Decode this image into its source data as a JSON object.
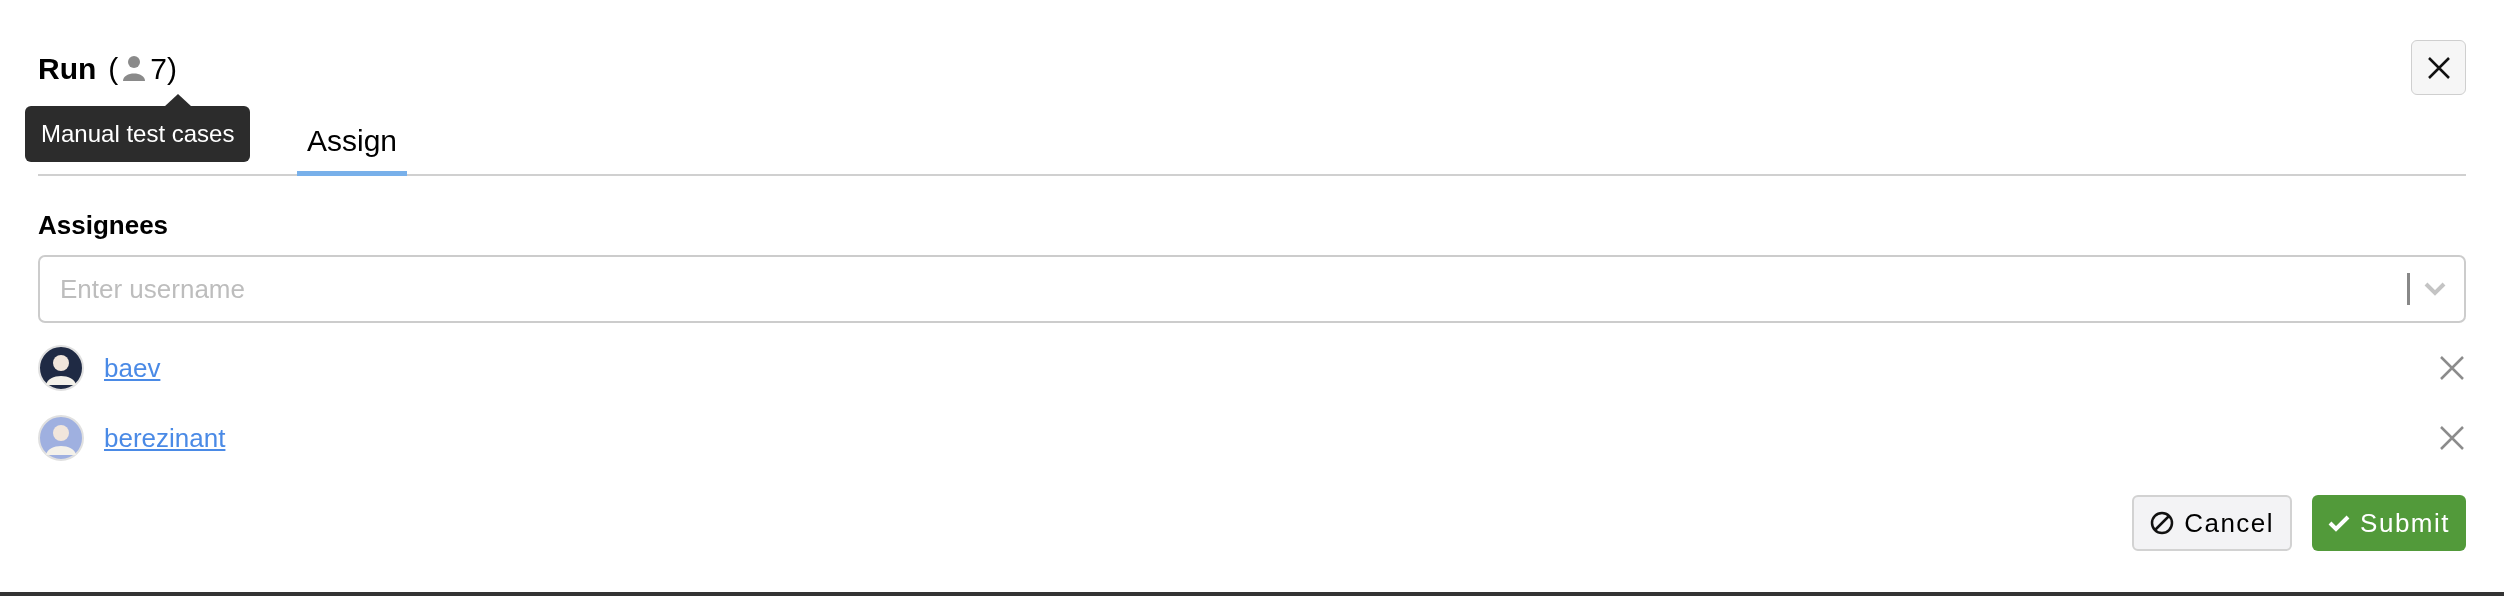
{
  "dialog": {
    "title": "Run",
    "paren_open": "(",
    "count": "7",
    "paren_close": ")",
    "tooltip": "Manual test cases"
  },
  "tabs": [
    {
      "label": "Assign",
      "selected": true
    }
  ],
  "assignees": {
    "label": "Assignees",
    "placeholder": "Enter username",
    "users": [
      {
        "name": "baev",
        "color": "#1f2a44"
      },
      {
        "name": "berezinant",
        "color": "#9fb0e0"
      }
    ]
  },
  "buttons": [
    {
      "kind": "cancel",
      "label": "Cancel"
    },
    {
      "kind": "submit",
      "label": "Submit"
    }
  ]
}
